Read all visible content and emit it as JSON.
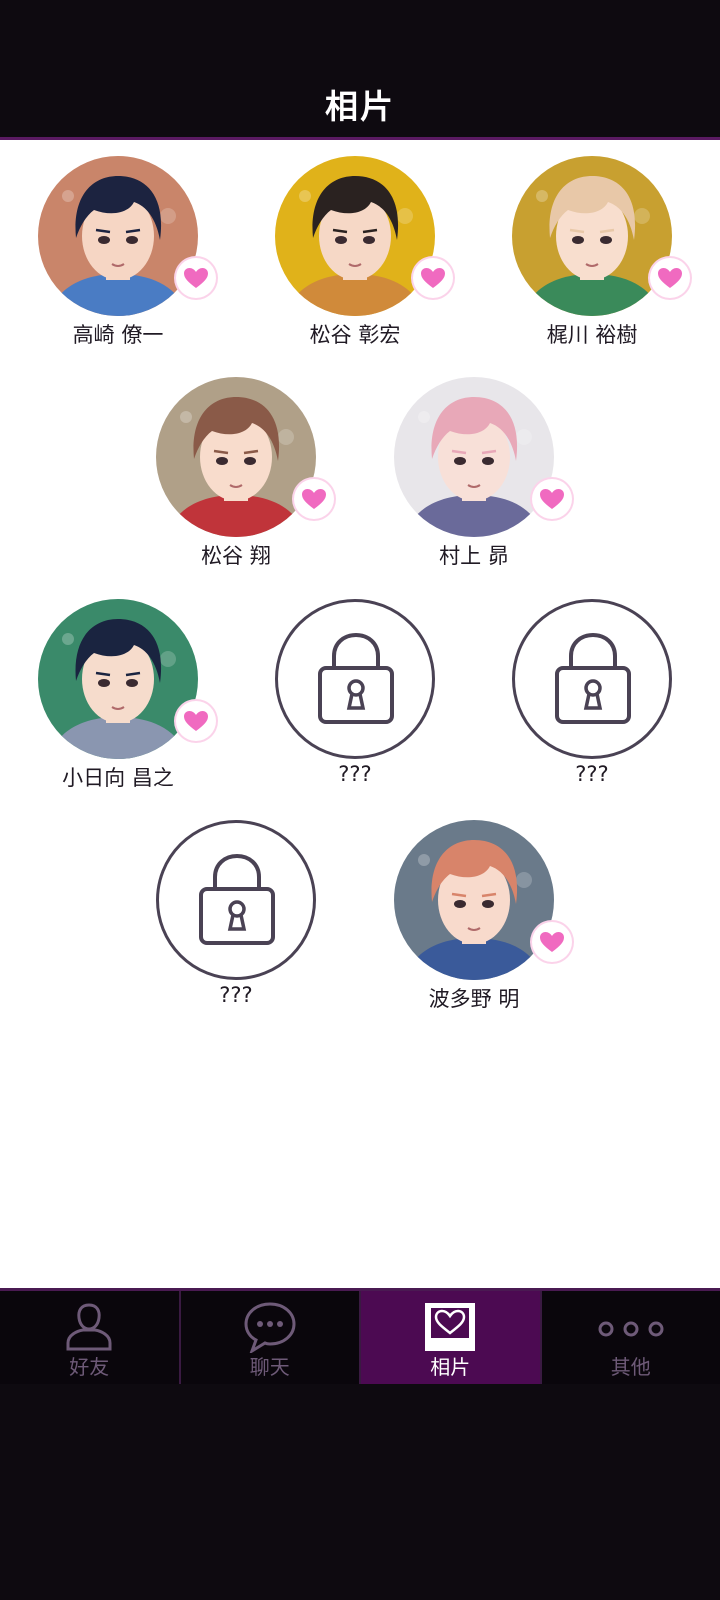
{
  "header": {
    "title": "相片"
  },
  "characters": [
    {
      "name": "高崎 僚一",
      "locked": false,
      "bg": "#c9856a",
      "hair": "#1c2340",
      "skin": "#f6d6c4",
      "accent": "#4a7cc4"
    },
    {
      "name": "松谷 彰宏",
      "locked": false,
      "bg": "#e0b21a",
      "hair": "#2a2220",
      "skin": "#f6d8c6",
      "accent": "#d08a3a"
    },
    {
      "name": "梶川 裕樹",
      "locked": false,
      "bg": "#c8a030",
      "hair": "#e8c8a8",
      "skin": "#f8dece",
      "accent": "#3a8a5a"
    },
    {
      "name": "松谷 翔",
      "locked": false,
      "bg": "#b0a088",
      "hair": "#8a5a48",
      "skin": "#f8dccc",
      "accent": "#c0343a"
    },
    {
      "name": "村上 昴",
      "locked": false,
      "bg": "#e8e6ea",
      "hair": "#e8a8b8",
      "skin": "#f8e0d8",
      "accent": "#6a6a9a"
    },
    {
      "name": "小日向 昌之",
      "locked": false,
      "bg": "#3a8a6a",
      "hair": "#1a2440",
      "skin": "#f6dccc",
      "accent": "#8a96b0"
    },
    {
      "name": "???",
      "locked": true
    },
    {
      "name": "???",
      "locked": true
    },
    {
      "name": "???",
      "locked": true
    },
    {
      "name": "波多野 明",
      "locked": false,
      "bg": "#6a7a8a",
      "hair": "#d8846a",
      "skin": "#f8dacc",
      "accent": "#3a5a9a"
    }
  ],
  "nav": [
    {
      "label": "好友",
      "icon": "person-icon",
      "active": false
    },
    {
      "label": "聊天",
      "icon": "chat-bubble-icon",
      "active": false
    },
    {
      "label": "相片",
      "icon": "photo-heart-icon",
      "active": true
    },
    {
      "label": "其他",
      "icon": "more-dots-icon",
      "active": false
    }
  ],
  "colors": {
    "accent": "#4c0a52",
    "heart": "#f06ac0",
    "lock": "#4a4254"
  }
}
